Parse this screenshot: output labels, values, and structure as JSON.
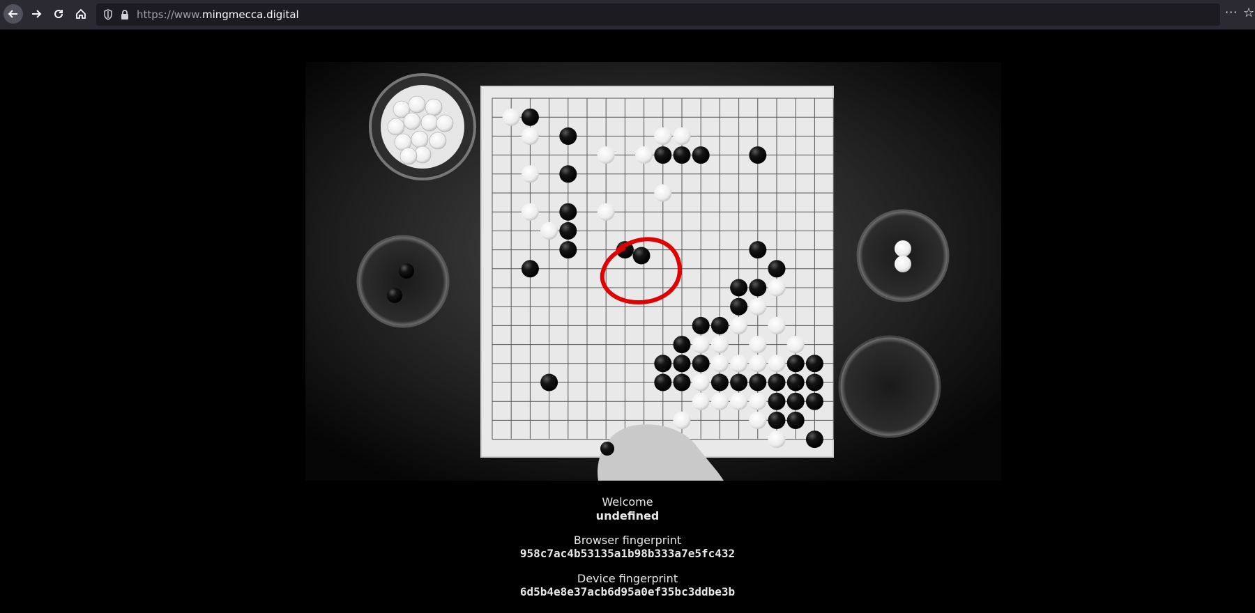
{
  "browser": {
    "url_prefix": "https://www.",
    "url_domain": "mingmecca.digital",
    "more_glyph": "···",
    "star_glyph": "☆",
    "icons": [
      "back-arrow-icon",
      "forward-arrow-icon",
      "reload-icon",
      "home-icon",
      "shield-icon",
      "lock-icon",
      "more-menu-icon",
      "bookmark-star-icon"
    ]
  },
  "page": {
    "welcome_label": "Welcome",
    "welcome_value": "undefined",
    "browser_fp_label": "Browser fingerprint",
    "browser_fp_value": "958c7ac4b53135a1b98b333a7e5fc432",
    "device_fp_label": "Device fingerprint",
    "device_fp_value": "6d5b4e8e37acb6d95a0ef35bc3ddbe3b"
  },
  "colors": {
    "toolbar_bg": "#2b2a33",
    "urlbar_bg": "#1c1b22",
    "page_bg": "#000000",
    "highlight_circle": "#e00000"
  }
}
